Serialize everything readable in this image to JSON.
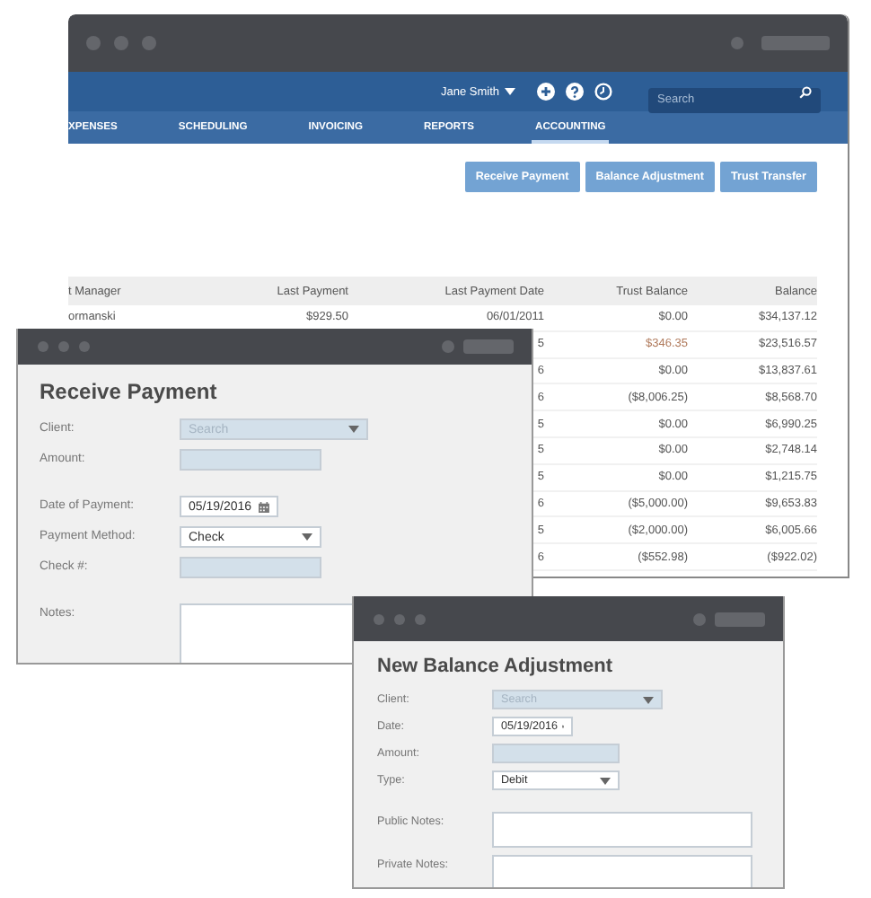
{
  "main_window": {
    "user_menu": "Jane Smith",
    "search": {
      "placeholder": "Search"
    },
    "nav": [
      {
        "label": "XPENSES",
        "selected": false
      },
      {
        "label": "SCHEDULING",
        "selected": false
      },
      {
        "label": "INVOICING",
        "selected": false
      },
      {
        "label": "REPORTS",
        "selected": false
      },
      {
        "label": "ACCOUNTING",
        "selected": true
      }
    ],
    "actions": [
      "Receive Payment",
      "Balance Adjustment",
      "Trust Transfer"
    ],
    "table": {
      "columns": [
        "t Manager",
        "Last Payment",
        "Last Payment Date",
        "Trust Balance",
        "Balance"
      ],
      "rows": [
        {
          "manager": "ormanski",
          "last_payment": "$929.50",
          "last_payment_date": "06/01/2011",
          "trust_balance": "$0.00",
          "balance": "$34,137.12",
          "color": "#555555"
        },
        {
          "last_payment_date": "5",
          "trust_balance": "$346.35",
          "balance": "$23,516.57",
          "color": "#b07a5c"
        },
        {
          "last_payment_date": "6",
          "trust_balance": "$0.00",
          "balance": "$13,837.61",
          "color": "#555555"
        },
        {
          "last_payment_date": "6",
          "trust_balance": "($8,006.25)",
          "balance": "$8,568.70",
          "color": "#555555"
        },
        {
          "last_payment_date": "5",
          "trust_balance": "$0.00",
          "balance": "$6,990.25",
          "color": "#555555"
        },
        {
          "last_payment_date": "5",
          "trust_balance": "$0.00",
          "balance": "$2,748.14",
          "color": "#555555"
        },
        {
          "last_payment_date": "5",
          "trust_balance": "$0.00",
          "balance": "$1,215.75",
          "color": "#555555"
        },
        {
          "last_payment_date": "6",
          "trust_balance": "($5,000.00)",
          "balance": "$9,653.83",
          "color": "#555555"
        },
        {
          "last_payment_date": "5",
          "trust_balance": "($2,000.00)",
          "balance": "$6,005.66",
          "color": "#555555"
        },
        {
          "last_payment_date": "6",
          "trust_balance": "($552.98)",
          "balance": "($922.02)",
          "color": "#555555"
        }
      ]
    }
  },
  "receive_payment": {
    "title": "Receive Payment",
    "field_groups": [
      [
        {
          "label": "Client:",
          "kind": "combo",
          "placeholder": "Search"
        },
        {
          "label": "Amount:",
          "kind": "text"
        }
      ],
      [
        {
          "label": "Date of Payment:",
          "kind": "date",
          "value": "05/19/2016"
        },
        {
          "label": "Payment Method:",
          "kind": "select",
          "value": "Check"
        },
        {
          "label": "Check #:",
          "kind": "text"
        }
      ],
      [
        {
          "label": "Notes:",
          "kind": "textarea"
        }
      ]
    ]
  },
  "balance_adjustment": {
    "title": "New Balance Adjustment",
    "field_groups": [
      [
        {
          "label": "Client:",
          "kind": "combo",
          "placeholder": "Search"
        },
        {
          "label": "Date:",
          "kind": "date",
          "value": "05/19/2016"
        },
        {
          "label": "Amount:",
          "kind": "text"
        },
        {
          "label": "Type:",
          "kind": "select",
          "value": "Debit"
        }
      ],
      [
        {
          "label": "Public Notes:",
          "kind": "textarea"
        },
        {
          "label": "Private Notes:",
          "kind": "textarea"
        }
      ]
    ]
  }
}
